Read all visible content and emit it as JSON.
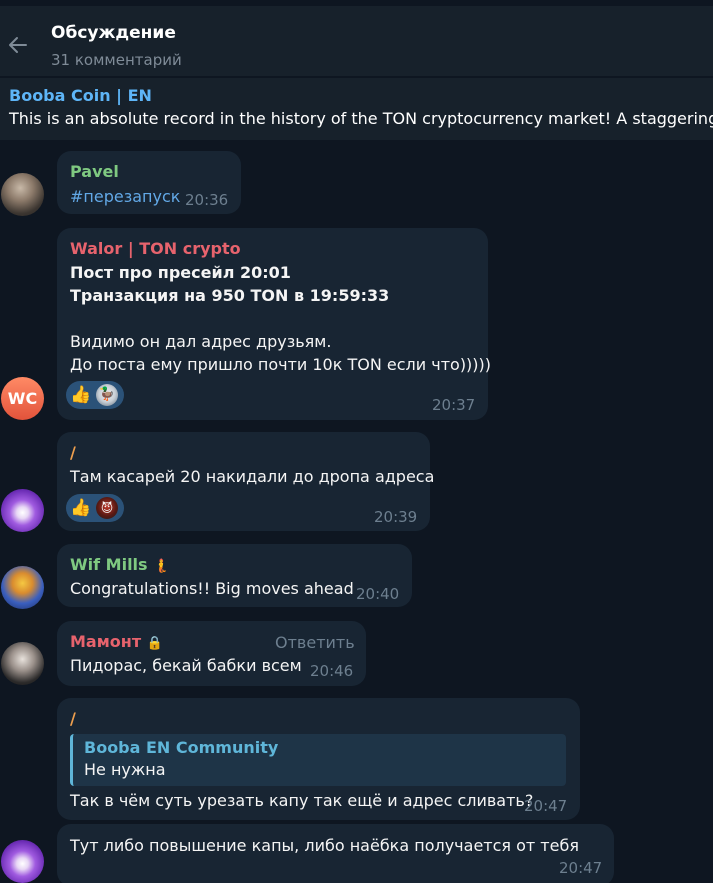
{
  "header": {
    "title": "Обсуждение",
    "subtitle": "31 комментарий"
  },
  "pinned": {
    "title": "Booba Coin | EN",
    "text": "This is an absolute record in the history of the TON cryptocurrency market! A staggering am"
  },
  "avatars": {
    "wc_initials": "WC"
  },
  "messages": [
    {
      "author": "Pavel",
      "author_color": "#7fc981",
      "text": "#перезапуск",
      "time": "20:36"
    },
    {
      "author": "Walor | TON crypto",
      "author_color": "#e7636d",
      "lines": [
        "Пост про пресейл 20:01",
        "Транзакция на 950 TON в 19:59:33",
        "Видимо он дал адрес друзьям.",
        "До поста ему пришло почти 10к TON если что)))))"
      ],
      "reactions": [
        "👍",
        "🦆"
      ],
      "time": "20:37"
    },
    {
      "author": "/",
      "author_color": "#ee9f4e",
      "text": "Там касарей 20 накидали до дропа адреса",
      "reactions": [
        "👍",
        "😈"
      ],
      "time": "20:39"
    },
    {
      "author": "Wif Mills",
      "author_color": "#7fc981",
      "author_badge": "🧜",
      "text": "Congratulations!! Big moves ahead",
      "time": "20:40"
    },
    {
      "author": "Мамонт",
      "author_color": "#e7636d",
      "author_badge": "🔒",
      "reply_label": "Ответить",
      "text": "Пидорас, бекай бабки всем",
      "time": "20:46"
    },
    {
      "author": "/",
      "author_color": "#ee9f4e",
      "quote_author": "Booba EN Community",
      "quote_text": "Не нужна",
      "text": "Так в чём суть урезать капу так ещё и адрес сливать?",
      "time": "20:47"
    },
    {
      "text": "Тут либо повышение капы, либо наёбка получается от тебя",
      "time": "20:47"
    }
  ]
}
